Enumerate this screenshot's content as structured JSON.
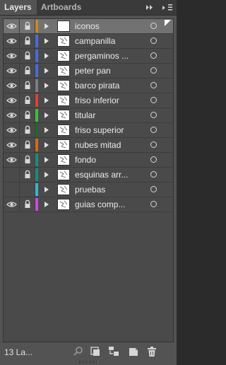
{
  "tabs": [
    {
      "label": "Layers",
      "active": true
    },
    {
      "label": "Artboards",
      "active": false
    }
  ],
  "layers": [
    {
      "name": "iconos",
      "color": "#c9862d",
      "visible": true,
      "locked": true,
      "selected": true
    },
    {
      "name": "campanilla",
      "color": "#4b6bd8",
      "visible": true,
      "locked": true,
      "selected": false
    },
    {
      "name": "pergaminos ...",
      "color": "#4b6bd8",
      "visible": true,
      "locked": true,
      "selected": false
    },
    {
      "name": "peter pan",
      "color": "#4b6bd8",
      "visible": true,
      "locked": true,
      "selected": false
    },
    {
      "name": "barco pirata",
      "color": "#7d7d8a",
      "visible": true,
      "locked": true,
      "selected": false
    },
    {
      "name": "friso inferior",
      "color": "#d84242",
      "visible": true,
      "locked": true,
      "selected": false
    },
    {
      "name": "titular",
      "color": "#3fbf3f",
      "visible": true,
      "locked": true,
      "selected": false
    },
    {
      "name": "friso superior",
      "color": "#1f6a2a",
      "visible": true,
      "locked": true,
      "selected": false
    },
    {
      "name": "nubes mitad",
      "color": "#d06a1e",
      "visible": true,
      "locked": true,
      "selected": false
    },
    {
      "name": "fondo",
      "color": "#1e8c7e",
      "visible": true,
      "locked": true,
      "selected": false
    },
    {
      "name": "esquinas arr...",
      "color": "#1e8c7e",
      "visible": false,
      "locked": true,
      "selected": false
    },
    {
      "name": "pruebas",
      "color": "#3ab6c7",
      "visible": false,
      "locked": false,
      "selected": false
    },
    {
      "name": "guias comp...",
      "color": "#c84ad6",
      "visible": true,
      "locked": true,
      "selected": false
    }
  ],
  "footer": {
    "count_label": "13 La...",
    "buttons": [
      "locate-object",
      "make-clipping-mask",
      "create-sublayer",
      "create-new-layer",
      "delete-layer"
    ]
  }
}
